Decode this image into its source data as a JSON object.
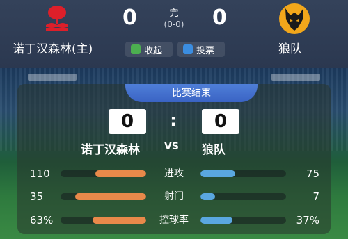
{
  "match": {
    "status": "完",
    "halftime": "(0-0)",
    "home_score": "0",
    "away_score": "0"
  },
  "home": {
    "name": "诺丁汉森林(主)",
    "short": "诺丁汉森林",
    "logo": "nottingham-forest-crest-icon",
    "color": "#dd1f2a"
  },
  "away": {
    "name": "狼队",
    "short": "狼队",
    "logo": "wolves-crest-icon",
    "color": "#f2a71b"
  },
  "actions": {
    "fold": "收起",
    "vote": "投票"
  },
  "card": {
    "title": "比赛结束",
    "home_score": "0",
    "away_score": "0",
    "colon": ":",
    "vs": "VS"
  },
  "stats": [
    {
      "label": "进攻",
      "home": "110",
      "away": "75",
      "home_share": 0.595,
      "away_share": 0.405
    },
    {
      "label": "射门",
      "home": "35",
      "away": "7",
      "home_share": 0.833,
      "away_share": 0.167
    },
    {
      "label": "控球率",
      "home": "63%",
      "away": "37%",
      "home_share": 0.63,
      "away_share": 0.37
    }
  ],
  "colors": {
    "home_bar": "#e8894a",
    "away_bar": "#5aa7e0",
    "title_bar": "#3a63c4"
  }
}
